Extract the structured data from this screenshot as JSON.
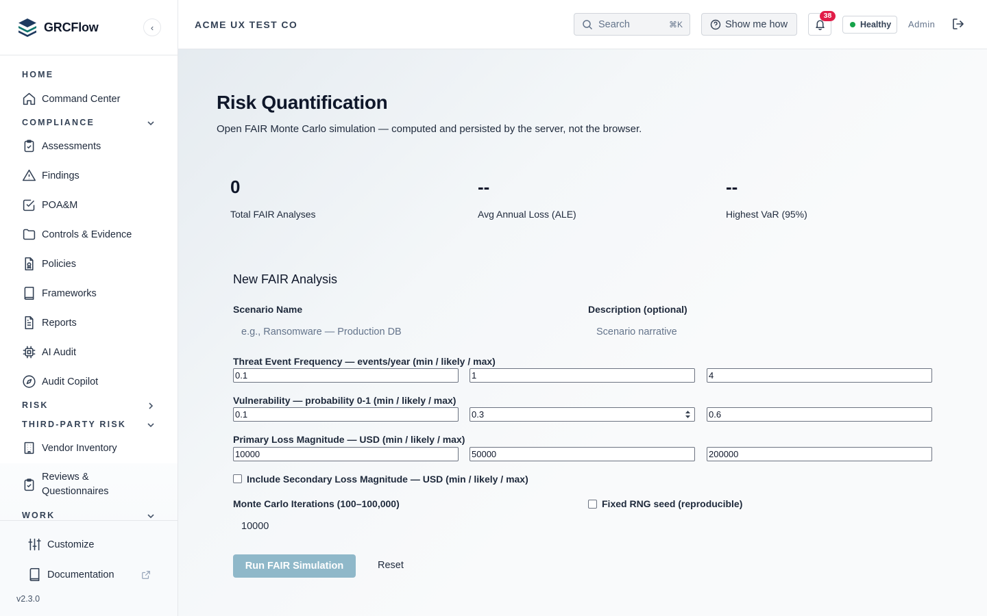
{
  "brand": {
    "name": "GRCFlow",
    "collapse_glyph": "‹"
  },
  "sidebar": {
    "sections": {
      "home": "HOME",
      "compliance": "COMPLIANCE",
      "risk": "RISK",
      "third_party": "THIRD-PARTY RISK",
      "work": "WORK"
    },
    "items": {
      "command_center": "Command Center",
      "assessments": "Assessments",
      "findings": "Findings",
      "poam": "POA&M",
      "controls": "Controls & Evidence",
      "policies": "Policies",
      "frameworks": "Frameworks",
      "reports": "Reports",
      "ai_audit": "AI Audit",
      "audit_copilot": "Audit Copilot",
      "vendor_inventory": "Vendor Inventory",
      "reviews_line1": "Reviews &",
      "reviews_line2": "Questionnaires"
    },
    "footer": {
      "customize": "Customize",
      "documentation": "Documentation",
      "version": "v2.3.0"
    }
  },
  "header": {
    "org": "ACME UX TEST CO",
    "search_placeholder": "Search",
    "search_shortcut": "⌘K",
    "show_me_how": "Show me how",
    "notifications_count": "38",
    "health": "Healthy",
    "health_color": "#16a34a",
    "user_role": "Admin"
  },
  "page": {
    "title": "Risk Quantification",
    "subtitle": "Open FAIR Monte Carlo simulation — computed and persisted by the server, not the browser."
  },
  "stats": [
    {
      "value": "0",
      "label": "Total FAIR Analyses"
    },
    {
      "value": "--",
      "label": "Avg Annual Loss (ALE)"
    },
    {
      "value": "--",
      "label": "Highest VaR (95%)"
    }
  ],
  "form": {
    "title": "New FAIR Analysis",
    "scenario_label": "Scenario Name",
    "scenario_placeholder": "e.g., Ransomware — Production DB",
    "description_label": "Description (optional)",
    "description_placeholder": "Scenario narrative",
    "tef_label": "Threat Event Frequency — events/year (min / likely / max)",
    "tef_values": [
      "0.1",
      "1",
      "4"
    ],
    "vuln_label": "Vulnerability — probability 0-1 (min / likely / max)",
    "vuln_values": [
      "0.1",
      "0.3",
      "0.6"
    ],
    "plm_label": "Primary Loss Magnitude — USD (min / likely / max)",
    "plm_values": [
      "10000",
      "50000",
      "200000"
    ],
    "secondary_label": "Include Secondary Loss Magnitude — USD (min / likely / max)",
    "iterations_label": "Monte Carlo Iterations (100–100,000)",
    "iterations_value": "10000",
    "seed_label": "Fixed RNG seed (reproducible)",
    "run_label": "Run FAIR Simulation",
    "reset_label": "Reset"
  }
}
